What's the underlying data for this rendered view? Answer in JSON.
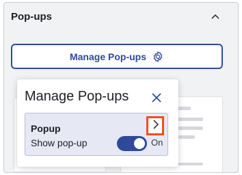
{
  "section": {
    "title": "Pop-ups",
    "collapse_icon": "chevron-up-icon"
  },
  "manage_button": {
    "label": "Manage Pop-ups",
    "icon": "gear-icon"
  },
  "panel": {
    "title": "Manage Pop-ups",
    "close_icon": "close-icon",
    "item": {
      "title": "Popup",
      "toggle_label": "Show pop-up",
      "toggle_state": "On",
      "toggle_on": true,
      "open_icon": "chevron-right-icon"
    }
  },
  "colors": {
    "accent": "#2f4a9a",
    "highlight": "#f04e23",
    "card_bg": "#e6e8f4"
  }
}
